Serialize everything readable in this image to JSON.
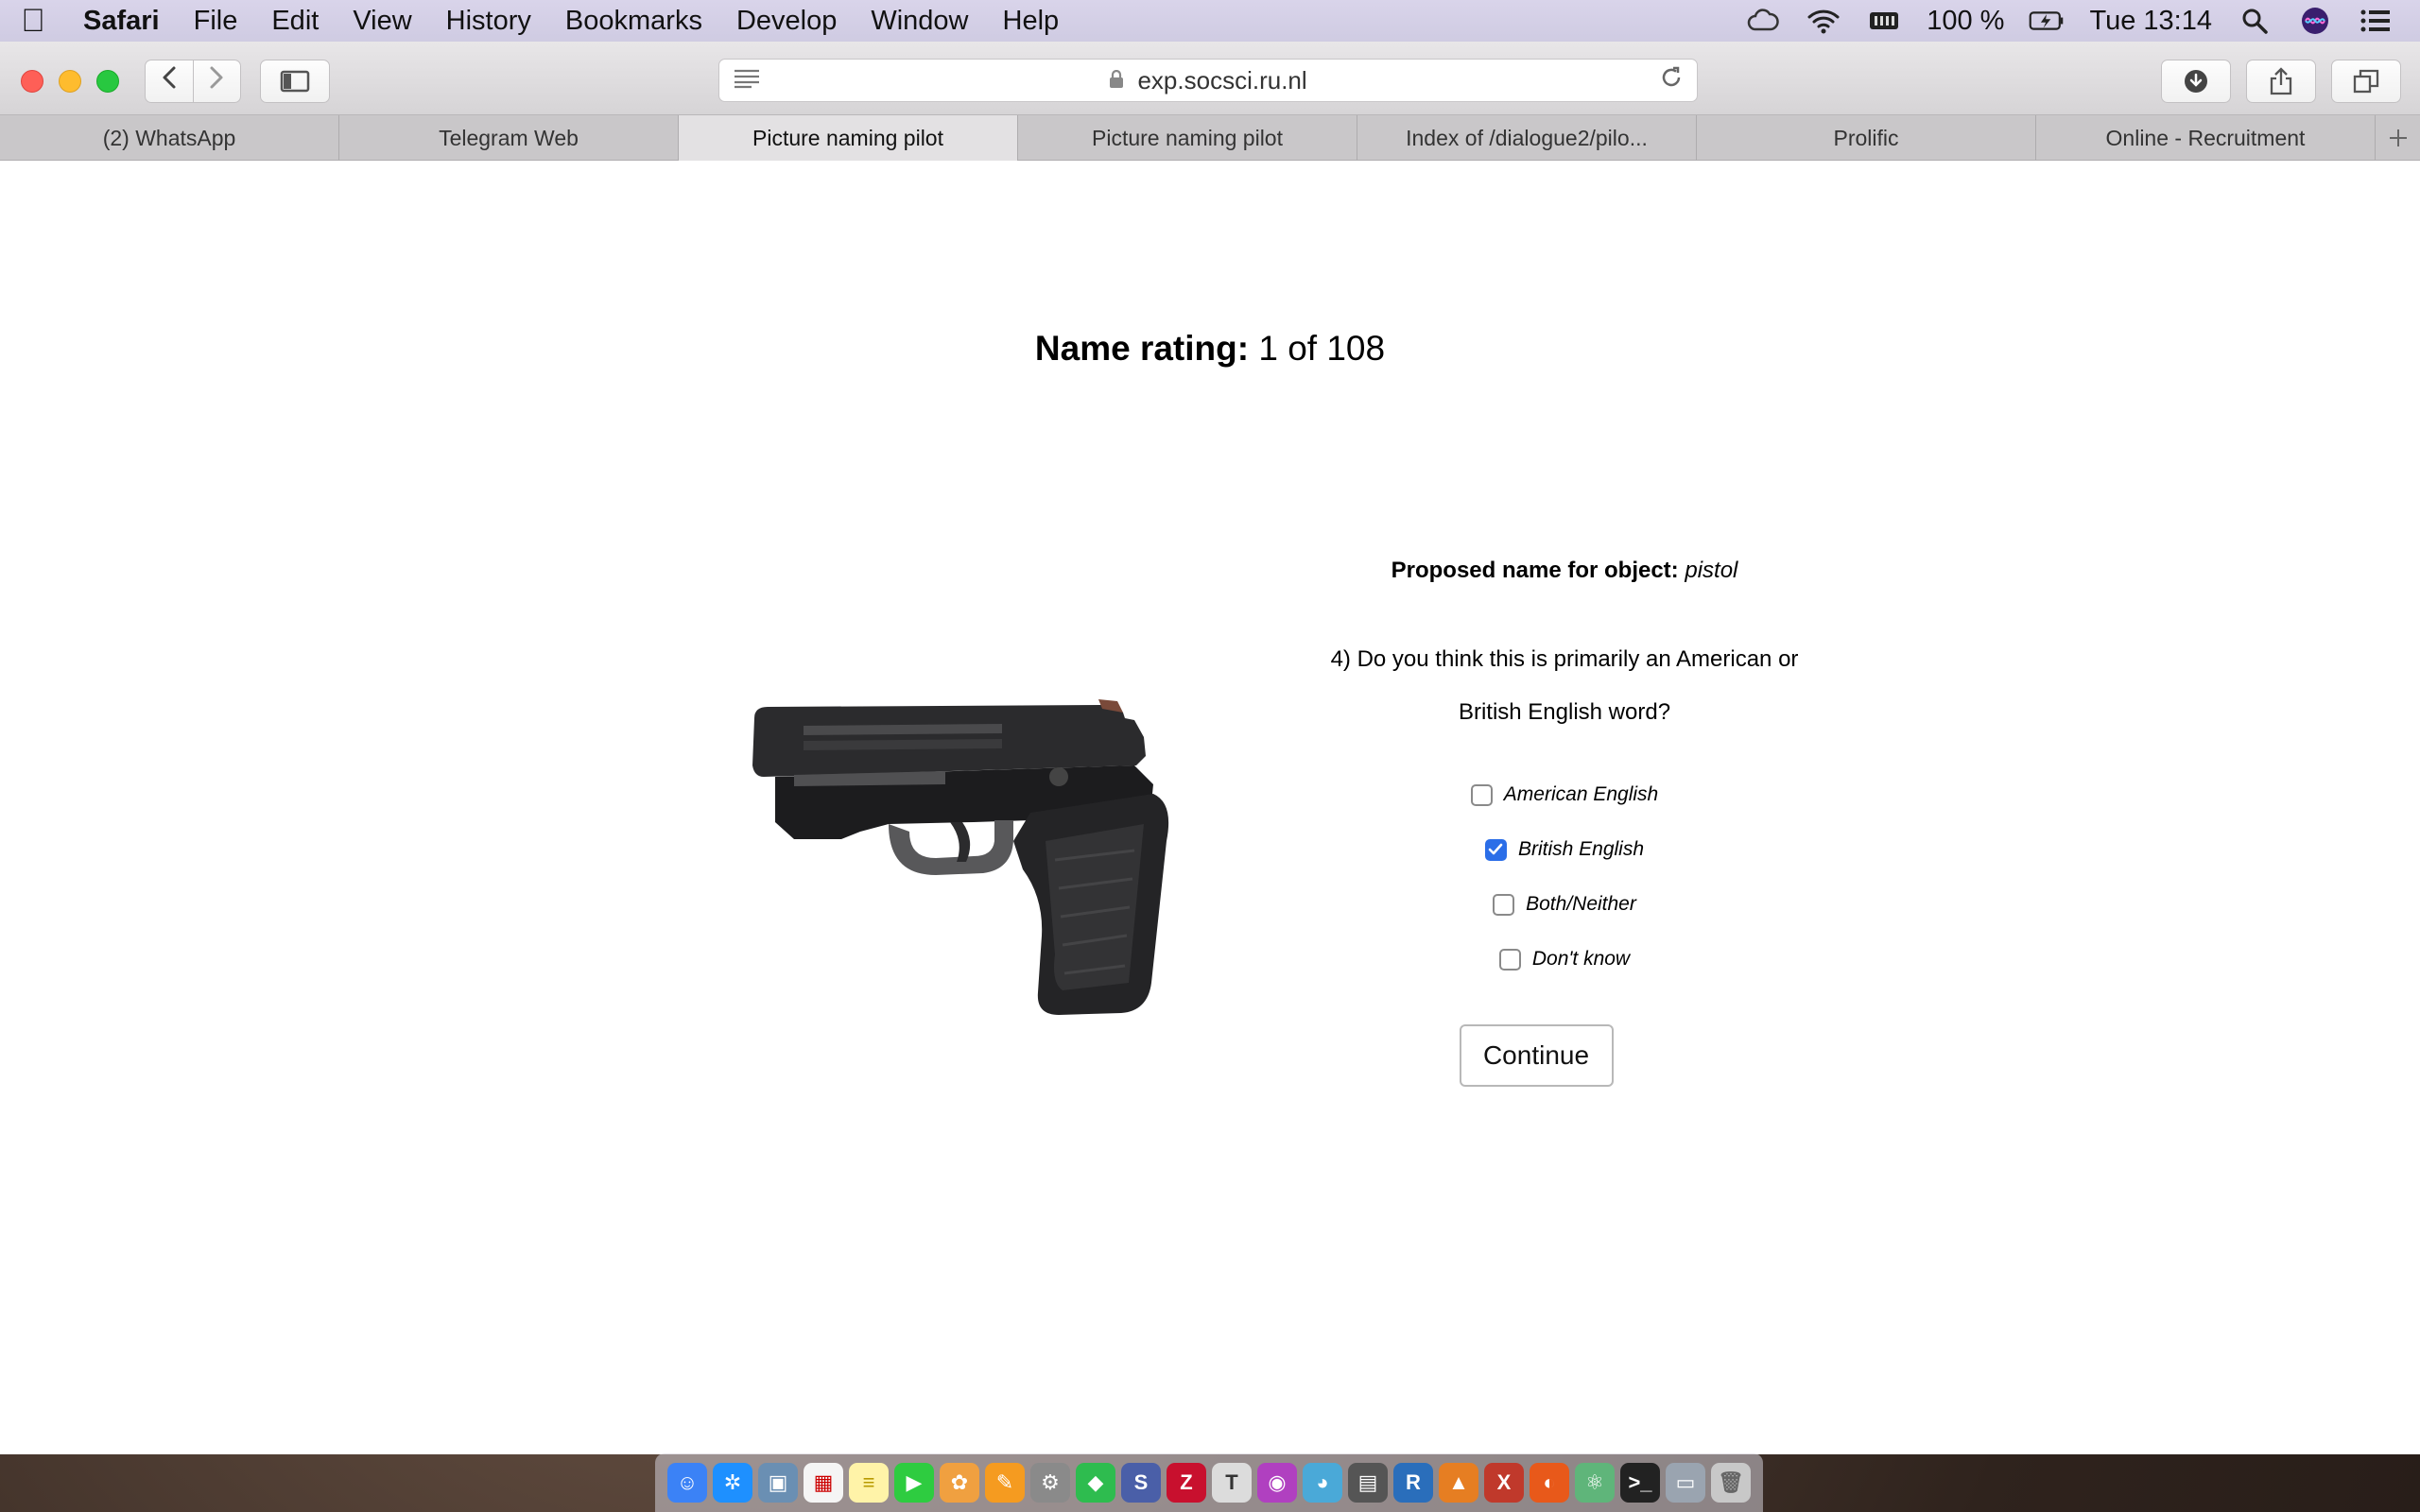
{
  "menubar": {
    "app_name": "Safari",
    "items": [
      "File",
      "Edit",
      "View",
      "History",
      "Bookmarks",
      "Develop",
      "Window",
      "Help"
    ],
    "battery": "100 %",
    "clock": "Tue 13:14"
  },
  "toolbar": {
    "url": "exp.socsci.ru.nl"
  },
  "tabs": [
    {
      "label": "(2) WhatsApp"
    },
    {
      "label": "Telegram Web"
    },
    {
      "label": "Picture naming pilot"
    },
    {
      "label": "Picture naming pilot"
    },
    {
      "label": "Index of /dialogue2/pilo..."
    },
    {
      "label": "Prolific"
    },
    {
      "label": "Online - Recruitment"
    }
  ],
  "page": {
    "title_prefix": "Name rating:",
    "progress": "1 of 108",
    "proposed_label": "Proposed name for object:",
    "proposed_name": "pistol",
    "question_line1": "4) Do you think this is primarily an American or",
    "question_line2": "British English word?",
    "options": [
      {
        "label": "American English",
        "checked": false
      },
      {
        "label": "British English",
        "checked": true
      },
      {
        "label": "Both/Neither",
        "checked": false
      },
      {
        "label": "Don't know",
        "checked": false
      }
    ],
    "continue_label": "Continue"
  },
  "colors": {
    "checkbox_checked": "#2b6ee8"
  },
  "dock": {
    "items": [
      "finder",
      "safari",
      "preview",
      "calendar",
      "notes",
      "facetime",
      "photos",
      "pages",
      "system-preferences",
      "feedly",
      "scrivener",
      "zotero",
      "texmaker",
      "cyberduck",
      "tweetbot",
      "wireshark",
      "r",
      "matlab",
      "xquartz",
      "firefox",
      "atom",
      "terminal",
      "image-capture",
      "trash"
    ]
  }
}
